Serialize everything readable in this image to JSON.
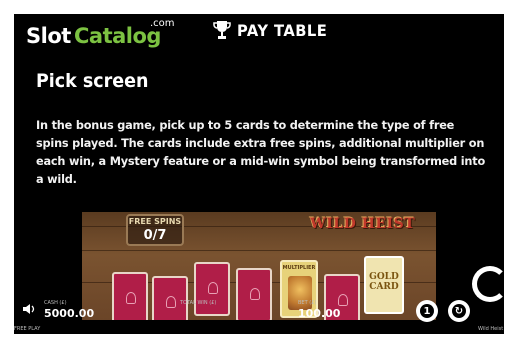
{
  "header": {
    "logo_slot": "Slot",
    "logo_catalog": "Catalog",
    "logo_com": ".com",
    "paytable_label": "PAY TABLE"
  },
  "content": {
    "title": "Pick screen",
    "description": "In the bonus game, pick up to 5 cards to determine the type of free spins played. The cards include extra free spins, additional multiplier on each win, a Mystery feature or a mid-win symbol being transformed into a wild."
  },
  "preview": {
    "freespins_label": "FREE SPINS",
    "freespins_count": "0/7",
    "game_logo": "WILD HEIST",
    "multiplier_card_label": "MULTIPLIER",
    "gold_card_label": "GOLD CARD"
  },
  "bottombar": {
    "cash_label": "CASH (£)",
    "cash_value": "5000.00",
    "total_win_label": "TOTAL WIN (£)",
    "bet_label": "BET (£)",
    "bet_value": "100.00",
    "free_play_label": "FREE PLAY",
    "game_name_label": "Wild Heist"
  },
  "icons": {
    "trophy": "trophy-icon",
    "speaker": "speaker-icon",
    "info": "info-icon",
    "autoplay": "autoplay-icon",
    "spin": "spin-icon"
  },
  "colors": {
    "logo_green": "#7cc242",
    "background": "#000000",
    "card_red": "#b01e48"
  }
}
